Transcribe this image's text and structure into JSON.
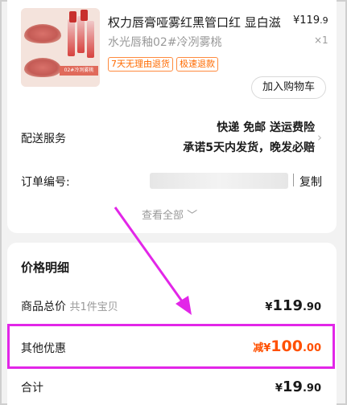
{
  "product": {
    "title": "权力唇膏哑雾红黑管口红 显白滋",
    "price_int": "¥119",
    "price_dec": ".9",
    "spec": "水光唇釉02#冷冽雾桃",
    "qty": "×1",
    "tags": [
      "7天无理由退货",
      "极速退款"
    ],
    "add_to_cart": "加入购物车",
    "thumb_caption": "02#冷冽雾桃"
  },
  "delivery": {
    "label": "配送服务",
    "line1": "快递 免邮 送运费险",
    "line2": "承诺5天内发货，晚发必赔"
  },
  "order": {
    "label": "订单编号:",
    "copy": "复制",
    "view_all": "查看全部 ﹀"
  },
  "price_detail": {
    "heading": "价格明细",
    "goods_total_label": "商品总价",
    "goods_total_note": "共1件宝贝",
    "goods_total_yen": "¥",
    "goods_total_int": "119",
    "goods_total_dec": ".90",
    "other_discount_label": "其他优惠",
    "discount_prefix": "减",
    "discount_yen": "¥",
    "discount_int": "100",
    "discount_dec": ".00",
    "total_label": "合计",
    "total_yen": "¥",
    "total_int": "19",
    "total_dec": ".90"
  },
  "colors": {
    "accent_orange": "#ff5000",
    "highlight_magenta": "#e226e8"
  }
}
